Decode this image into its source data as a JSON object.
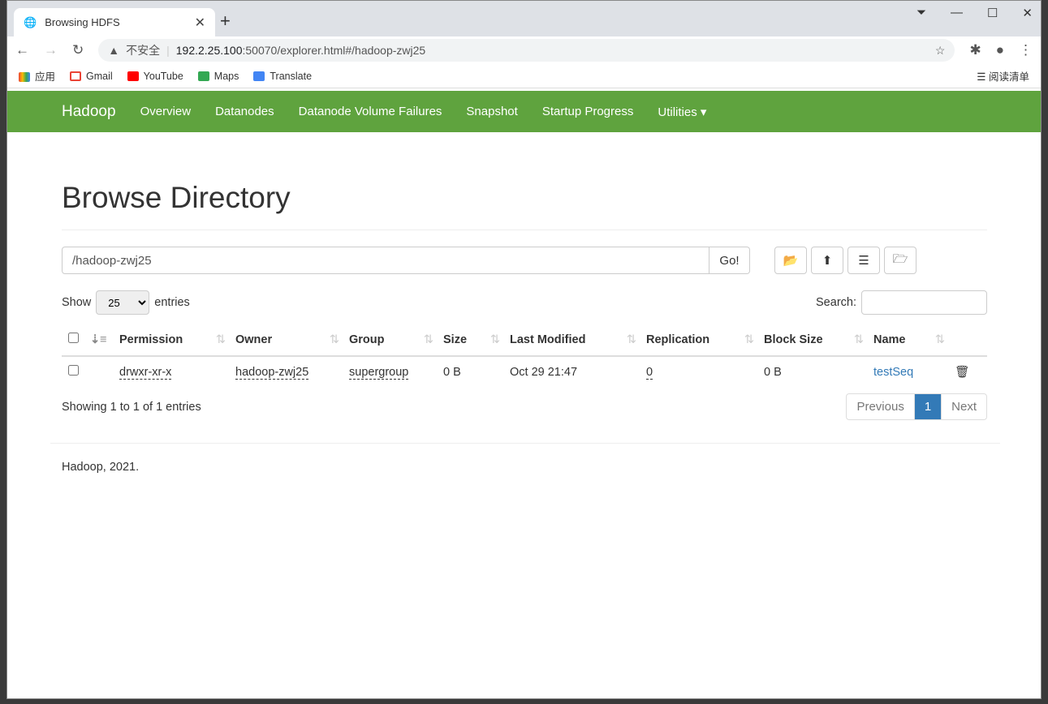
{
  "browser": {
    "tab_title": "Browsing HDFS",
    "security": "不安全",
    "url_host": "192.2.25.100",
    "url_rest": ":50070/explorer.html#/hadoop-zwj25",
    "bookmarks": [
      "应用",
      "Gmail",
      "YouTube",
      "Maps",
      "Translate"
    ],
    "reading_list": "阅读清单"
  },
  "nav": {
    "brand": "Hadoop",
    "items": [
      "Overview",
      "Datanodes",
      "Datanode Volume Failures",
      "Snapshot",
      "Startup Progress",
      "Utilities ▾"
    ]
  },
  "page": {
    "title": "Browse Directory",
    "path": "/hadoop-zwj25",
    "go": "Go!",
    "show": "Show",
    "entries_value": "25",
    "entries": "entries",
    "search": "Search:",
    "columns": [
      "Permission",
      "Owner",
      "Group",
      "Size",
      "Last Modified",
      "Replication",
      "Block Size",
      "Name"
    ],
    "rows": [
      {
        "permission": "drwxr-xr-x",
        "owner": "hadoop-zwj25",
        "group": "supergroup",
        "size": "0 B",
        "modified": "Oct 29 21:47",
        "replication": "0",
        "block_size": "0 B",
        "name": "testSeq"
      }
    ],
    "showing": "Showing 1 to 1 of 1 entries",
    "previous": "Previous",
    "page_num": "1",
    "next": "Next",
    "footer": "Hadoop, 2021."
  },
  "colors": {
    "navbar": "#5fa33e",
    "link": "#337ab7"
  }
}
